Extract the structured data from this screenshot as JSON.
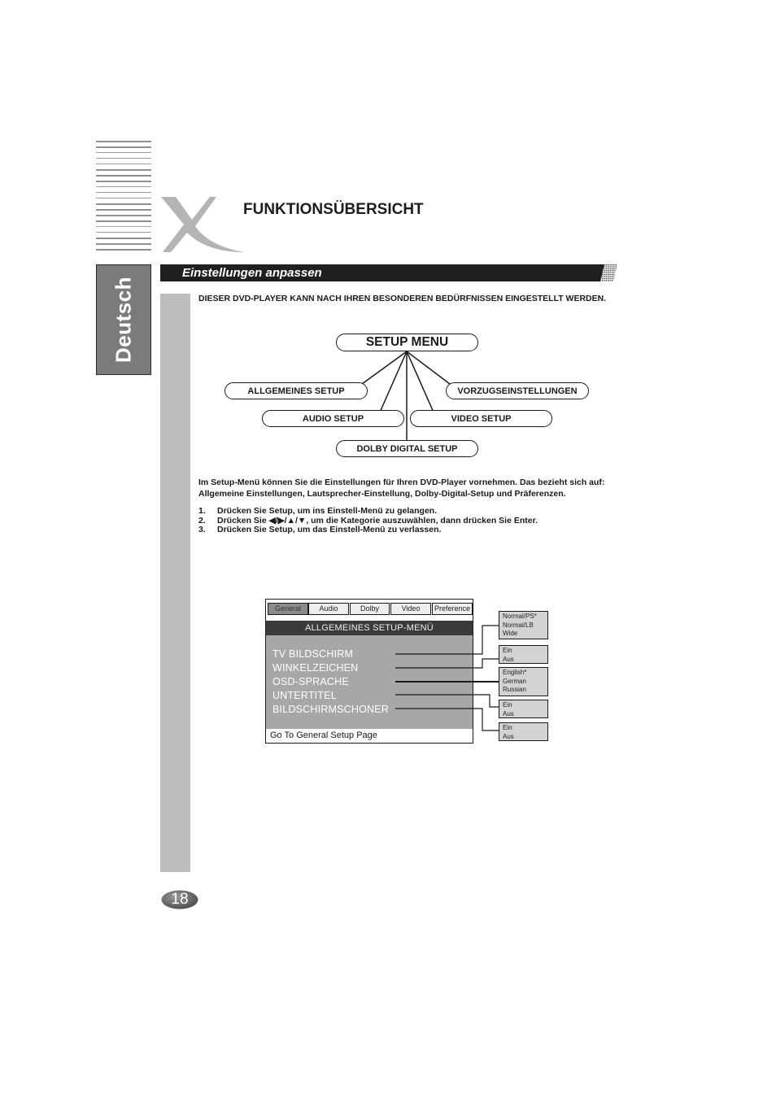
{
  "header": {
    "title": "FUNKTIONSÜBERSICHT",
    "logo_icon": "x-logo-icon",
    "language_tab": "Deutsch"
  },
  "section": {
    "title": "Einstellungen anpassen"
  },
  "intro": "DIESER DVD-PLAYER KANN NACH IHREN BESONDEREN BEDÜRFNISSEN EINGESTELLT WERDEN.",
  "diagram": {
    "root": "SETUP MENU",
    "children": [
      "ALLGEMEINES SETUP",
      "VORZUGSEINSTELLUNGEN",
      "AUDIO SETUP",
      "VIDEO SETUP",
      "DOLBY DIGITAL SETUP"
    ]
  },
  "description": "Im Setup-Menü können Sie die Einstellungen für Ihren DVD-Player vornehmen. Das bezieht sich auf:  Allgemeine Einstellungen, Lautsprecher-Einstellung, Dolby-Digital-Setup und Präferenzen.",
  "steps": [
    {
      "num": "1.",
      "text": "Drücken Sie Setup, um ins Einstell-Menü zu gelangen."
    },
    {
      "num": "2.",
      "text": "Drücken Sie ◀/▶/▲/▼, um die Kategorie auszuwählen, dann drücken Sie Enter."
    },
    {
      "num": "3.",
      "text": "Drücken Sie Setup, um das Einstell-Menü zu verlassen."
    }
  ],
  "setup_menu": {
    "tabs": [
      "General",
      "Audio",
      "Dolby",
      "Video",
      "Preference"
    ],
    "active_tab": "General",
    "title": "ALLGEMEINES SETUP-MENÜ",
    "items": [
      "TV BILDSCHIRM",
      "WINKELZEICHEN",
      "OSD-SPRACHE",
      "UNTERTITEL",
      "BILDSCHIRMSCHONER"
    ],
    "footer": "Go To General Setup Page",
    "options": [
      [
        "Normal/PS*",
        "Normal/LB",
        "Wide"
      ],
      [
        "Ein",
        "Aus"
      ],
      [
        "English*",
        "German",
        "Russian"
      ],
      [
        "Ein",
        "Aus"
      ],
      [
        "Ein",
        "Aus"
      ]
    ]
  },
  "page_number": "18"
}
